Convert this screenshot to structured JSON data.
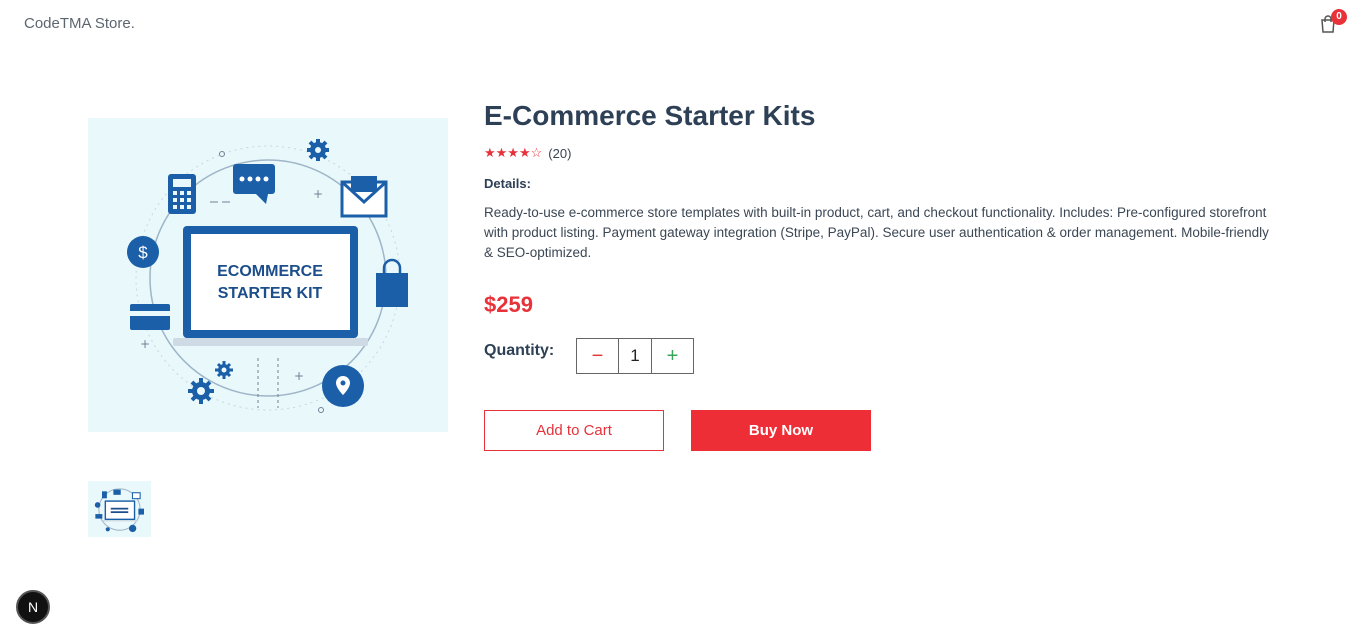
{
  "header": {
    "brand": "CodeTMA Store.",
    "cart_count": "0"
  },
  "product": {
    "image_text_line1": "ECOMMERCE",
    "image_text_line2": "STARTER KIT",
    "title": "E-Commerce Starter Kits",
    "rating": 4,
    "rating_max": 5,
    "stars_filled": "★★★★",
    "stars_empty": "☆",
    "rating_count": "(20)",
    "details_label": "Details:",
    "description": "Ready-to-use e-commerce store templates with built-in product, cart, and checkout functionality. Includes: Pre-configured storefront with product listing. Payment gateway integration (Stripe, PayPal). Secure user authentication & order management. Mobile-friendly & SEO-optimized.",
    "price": "$259"
  },
  "quantity": {
    "label": "Quantity:",
    "minus": "−",
    "value": "1",
    "plus": "+"
  },
  "actions": {
    "add_to_cart": "Add to Cart",
    "buy_now": "Buy Now"
  },
  "dev_badge": "N",
  "colors": {
    "accent": "#ee2e36",
    "heading": "#2d4055",
    "image_bg": "#e9f8fb",
    "icon_blue": "#1b5fa8"
  }
}
